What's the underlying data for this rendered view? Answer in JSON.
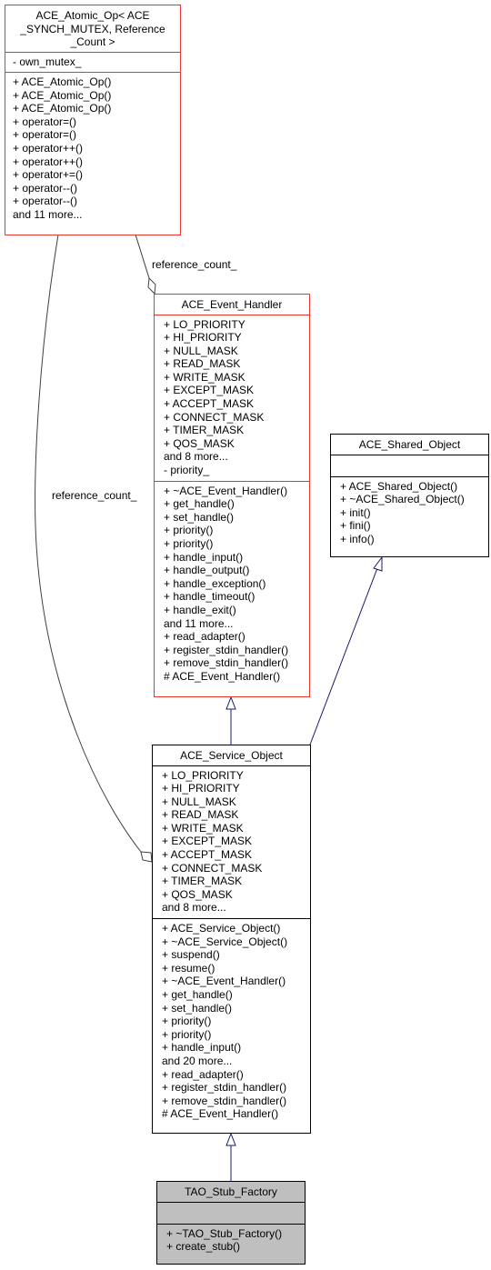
{
  "diagram": {
    "classes": {
      "atomic_op": {
        "title_lines": [
          "ACE_Atomic_Op< ACE",
          "_SYNCH_MUTEX, Reference",
          "_Count >"
        ],
        "attributes": [
          "- own_mutex_"
        ],
        "operations": [
          "+ ACE_Atomic_Op()",
          "+ ACE_Atomic_Op()",
          "+ ACE_Atomic_Op()",
          "+ operator=()",
          "+ operator=()",
          "+ operator++()",
          "+ operator++()",
          "+ operator+=()",
          "+ operator--()",
          "+ operator--()",
          "and 11 more..."
        ],
        "border_color": "#e5372e"
      },
      "event_handler": {
        "title": "ACE_Event_Handler",
        "attributes": [
          "+ LO_PRIORITY",
          "+ HI_PRIORITY",
          "+ NULL_MASK",
          "+ READ_MASK",
          "+ WRITE_MASK",
          "+ EXCEPT_MASK",
          "+ ACCEPT_MASK",
          "+ CONNECT_MASK",
          "+ TIMER_MASK",
          "+ QOS_MASK",
          "and 8 more...",
          "- priority_"
        ],
        "operations": [
          "+ ~ACE_Event_Handler()",
          "+ get_handle()",
          "+ set_handle()",
          "+ priority()",
          "+ priority()",
          "+ handle_input()",
          "+ handle_output()",
          "+ handle_exception()",
          "+ handle_timeout()",
          "+ handle_exit()",
          "and 11 more...",
          "+ read_adapter()",
          "+ register_stdin_handler()",
          "+ remove_stdin_handler()",
          "# ACE_Event_Handler()"
        ],
        "border_color": "#e5372e"
      },
      "shared_object": {
        "title": "ACE_Shared_Object",
        "attributes": [],
        "operations": [
          "+ ACE_Shared_Object()",
          "+ ~ACE_Shared_Object()",
          "+ init()",
          "+ fini()",
          "+ info()"
        ],
        "border_color": "#000000"
      },
      "service_object": {
        "title": "ACE_Service_Object",
        "attributes": [
          "+ LO_PRIORITY",
          "+ HI_PRIORITY",
          "+ NULL_MASK",
          "+ READ_MASK",
          "+ WRITE_MASK",
          "+ EXCEPT_MASK",
          "+ ACCEPT_MASK",
          "+ CONNECT_MASK",
          "+ TIMER_MASK",
          "+ QOS_MASK",
          "and 8 more..."
        ],
        "operations": [
          "+ ACE_Service_Object()",
          "+ ~ACE_Service_Object()",
          "+ suspend()",
          "+ resume()",
          "+ ~ACE_Event_Handler()",
          "+ get_handle()",
          "+ set_handle()",
          "+ priority()",
          "+ priority()",
          "+ handle_input()",
          "and 20 more...",
          "+ read_adapter()",
          "+ register_stdin_handler()",
          "+ remove_stdin_handler()",
          "# ACE_Event_Handler()"
        ],
        "border_color": "#000000"
      },
      "stub_factory": {
        "title": "TAO_Stub_Factory",
        "attributes": [],
        "operations": [
          "+ ~TAO_Stub_Factory()",
          "+ create_stub()"
        ],
        "fill_color": "#bfbfbf"
      }
    },
    "edges": [
      {
        "from": "atomic_op",
        "to": "event_handler",
        "type": "aggregation",
        "label": "reference_count_"
      },
      {
        "from": "atomic_op",
        "to": "service_object",
        "type": "aggregation",
        "label": "reference_count_"
      },
      {
        "from": "service_object",
        "to": "event_handler",
        "type": "inheritance"
      },
      {
        "from": "service_object",
        "to": "shared_object",
        "type": "inheritance"
      },
      {
        "from": "stub_factory",
        "to": "service_object",
        "type": "inheritance"
      }
    ],
    "colors": {
      "inheritance_edge": "#191970",
      "aggregation_edge": "#404040"
    }
  }
}
